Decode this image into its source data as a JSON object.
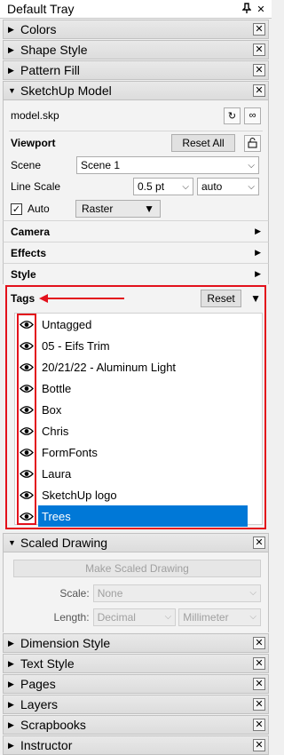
{
  "tray": {
    "title": "Default Tray"
  },
  "panels_top": [
    {
      "label": "Colors"
    },
    {
      "label": "Shape Style"
    },
    {
      "label": "Pattern Fill"
    }
  ],
  "sketchup_model": {
    "label": "SketchUp Model",
    "file": "model.skp",
    "viewport_label": "Viewport",
    "reset_all": "Reset All",
    "scene_label": "Scene",
    "scene_value": "Scene 1",
    "line_scale_label": "Line Scale",
    "line_scale_value": "0.5 pt",
    "line_scale_mode": "auto",
    "auto_label": "Auto",
    "render_mode": "Raster",
    "camera": "Camera",
    "effects": "Effects",
    "style": "Style"
  },
  "tags": {
    "label": "Tags",
    "reset": "Reset",
    "items": [
      {
        "name": "Untagged"
      },
      {
        "name": "05 - Eifs Trim"
      },
      {
        "name": "20/21/22 - Aluminum Light"
      },
      {
        "name": "Bottle"
      },
      {
        "name": "Box"
      },
      {
        "name": "Chris"
      },
      {
        "name": "FormFonts"
      },
      {
        "name": "Laura"
      },
      {
        "name": "SketchUp logo"
      },
      {
        "name": "Trees"
      }
    ],
    "selected": "Trees"
  },
  "scaled_drawing": {
    "label": "Scaled Drawing",
    "make_button": "Make Scaled Drawing",
    "scale_label": "Scale:",
    "scale_value": "None",
    "length_label": "Length:",
    "length_format": "Decimal",
    "length_unit": "Millimeter"
  },
  "panels_bottom": [
    {
      "label": "Dimension Style"
    },
    {
      "label": "Text Style"
    },
    {
      "label": "Pages"
    },
    {
      "label": "Layers"
    },
    {
      "label": "Scrapbooks"
    },
    {
      "label": "Instructor"
    }
  ],
  "colors": {
    "highlight": "#e3101b",
    "selection": "#0078d7"
  }
}
